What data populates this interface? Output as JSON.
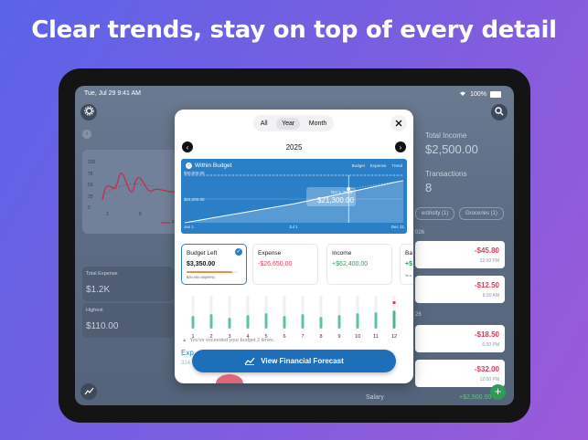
{
  "headline": "Clear trends, stay on top of every detail",
  "status": {
    "time": "Tue, Jul 29  9:41 AM",
    "battery": "100%"
  },
  "background": {
    "total_income_label": "Total Income",
    "total_income_value": "$2,500.00",
    "transactions_label": "Transactions",
    "transactions_value": "8",
    "chips": [
      "ectricity (1)",
      "Groceries (1)"
    ],
    "date1": "026",
    "date2": "26",
    "total_expense_label": "Total Expense",
    "total_expense_value": "$1.2K",
    "highest_label": "Highest",
    "highest_value": "$110.00",
    "mini_chart_ticks": [
      "100",
      "75",
      "50",
      "25",
      "0"
    ],
    "mini_chart_x": [
      "1",
      "5"
    ],
    "mini_legend": "Feb",
    "transactions_list": [
      {
        "amount": "-$45.80",
        "time": "12:00 PM"
      },
      {
        "amount": "-$12.50",
        "time": "8:00 AM"
      },
      {
        "amount": "-$18.50",
        "time": "6:00 PM"
      },
      {
        "amount": "-$32.00",
        "time": "12:00 PM"
      }
    ],
    "salary_label": "Salary",
    "salary_value": "+$2,500.00"
  },
  "modal": {
    "tabs": [
      "All",
      "Year",
      "Month"
    ],
    "active_tab": "Year",
    "year": "2025",
    "chart": {
      "status": "Within Budget",
      "legend": [
        "Budget",
        "Expense",
        "Trend"
      ],
      "y_labels": [
        "$30,000.00",
        "$15,000.00"
      ],
      "x_labels": [
        "Jan 1",
        "Jul 1",
        "Dec 31"
      ],
      "tooltip_date": "Oct 1, 2025",
      "tooltip_value": "$21,300.00"
    },
    "cards": [
      {
        "title": "Budget Left",
        "value": "$3,350.00",
        "sub": "$30,000.00(89%)"
      },
      {
        "title": "Expense",
        "value": "-$26,650.00"
      },
      {
        "title": "Income",
        "value": "+$62,400.00"
      },
      {
        "title": "Ba",
        "value": "+$",
        "sub": "% o"
      }
    ],
    "month_labels": [
      "1",
      "2",
      "3",
      "4",
      "5",
      "6",
      "7",
      "8",
      "9",
      "10",
      "11",
      "12"
    ],
    "warning": "You've exceeded your budget 2 times.",
    "peek_label": "Exp",
    "peek_sub": "324",
    "cta": "View Financial Forecast"
  },
  "chart_data": {
    "type": "line",
    "title": "Within Budget",
    "x": [
      "Jan 1",
      "Jul 1",
      "Dec 31"
    ],
    "series": [
      {
        "name": "Budget",
        "values": [
          30000,
          30000,
          30000
        ]
      },
      {
        "name": "Expense",
        "values": [
          0,
          12000,
          26650
        ]
      }
    ],
    "ylim": [
      0,
      30000
    ],
    "annotation": {
      "date": "Oct 1, 2025",
      "value": 21300
    }
  }
}
